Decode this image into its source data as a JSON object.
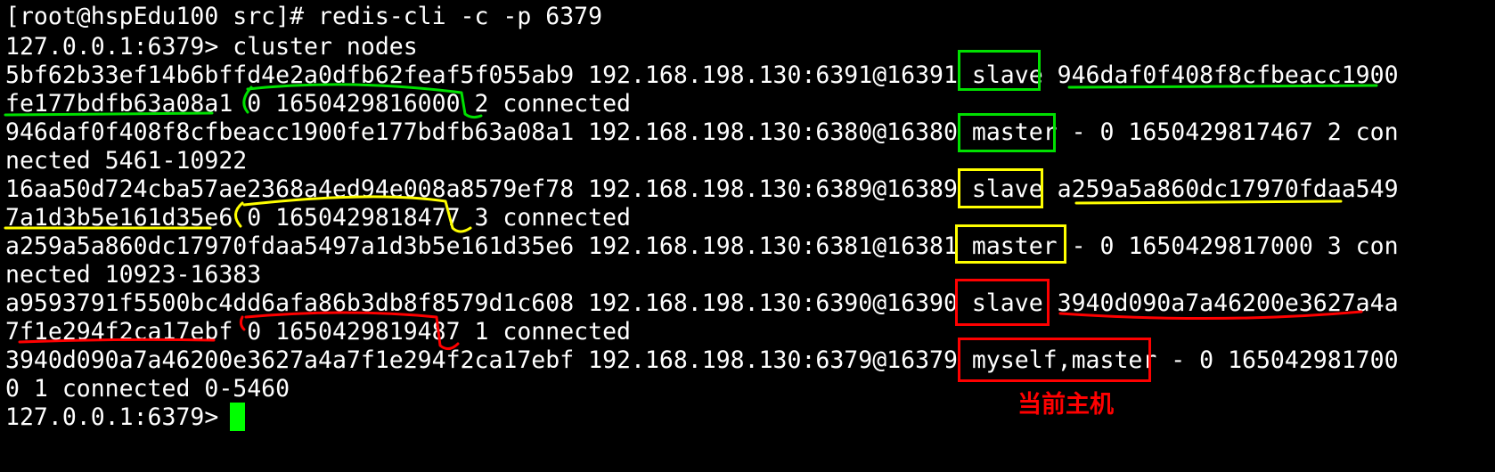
{
  "terminal": {
    "lines": [
      "[root@hspEdu100 src]# redis-cli -c -p 6379",
      "127.0.0.1:6379> cluster nodes",
      "5bf62b33ef14b6bffd4e2a0dfb62feaf5f055ab9 192.168.198.130:6391@16391 slave 946daf0f408f8cfbeacc1900",
      "fe177bdfb63a08a1 0 1650429816000 2 connected",
      "946daf0f408f8cfbeacc1900fe177bdfb63a08a1 192.168.198.130:6380@16380 master - 0 1650429817467 2 con",
      "nected 5461-10922",
      "16aa50d724cba57ae2368a4ed94e008a8579ef78 192.168.198.130:6389@16389 slave a259a5a860dc17970fdaa549",
      "7a1d3b5e161d35e6 0 1650429818477 3 connected",
      "a259a5a860dc17970fdaa5497a1d3b5e161d35e6 192.168.198.130:6381@16381 master - 0 1650429817000 3 con",
      "nected 10923-16383",
      "a9593791f5500bc4dd6afa86b3db8f8579d1c608 192.168.198.130:6390@16390 slave 3940d090a7a46200e3627a4a",
      "7f1e294f2ca17ebf 0 1650429819487 1 connected",
      "3940d090a7a46200e3627a4a7f1e294f2ca17ebf 192.168.198.130:6379@16379 myself,master - 0 165042981700",
      "0 1 connected 0-5460",
      "127.0.0.1:6379> "
    ]
  },
  "annotation": {
    "current_host_label": "当前主机"
  },
  "colors": {
    "background": "#000000",
    "text": "#ffffff",
    "cursor": "#00ff00",
    "green_mark": "#00e000",
    "yellow_mark": "#ffff00",
    "red_mark": "#ff0000"
  }
}
